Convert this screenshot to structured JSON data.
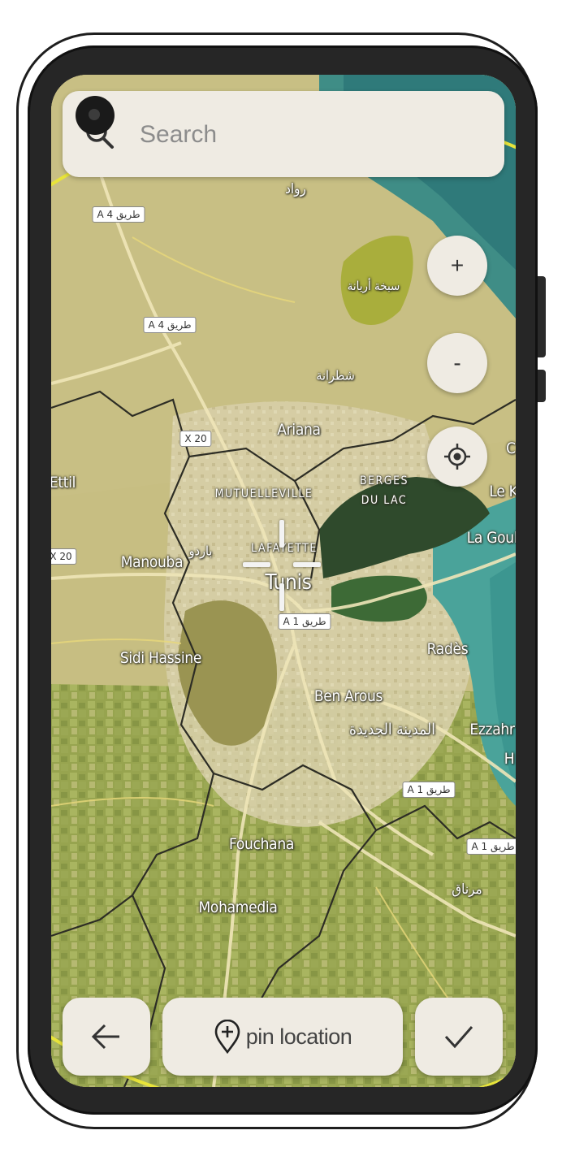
{
  "search": {
    "placeholder": "Search"
  },
  "map": {
    "labels": {
      "ariana": "Ariana",
      "mutuelleville": "MUTUELLEVILLE",
      "berges": "BERGES",
      "du_lac": "DU LAC",
      "lafayette": "LAFAYETTE",
      "tunis": "Tunis",
      "manouba": "Manouba",
      "sidi_hassine": "Sidi Hassine",
      "ben_arous": "Ben Arous",
      "rades": "Radès",
      "la_goulette": "La Goul",
      "le_k": "Le K",
      "fouchana": "Fouchana",
      "mohamedia": "Mohamedia",
      "ezzahra": "Ezzahr",
      "h": "H",
      "ettil": "Ettil",
      "c": "C",
      "arabic_sebkha": "سبخة أريانة",
      "arabic_raoued": "رواد",
      "arabic_chotrana": "شطرانة",
      "arabic_bardo": "باردو",
      "arabic_medina": "المدينة الجديدة",
      "arabic_mornag": "مرناق"
    },
    "shields": {
      "a4_top": "A 4 طريق",
      "a4_mid": "A 4 طريق",
      "x20_top": "X 20",
      "x20_left": "X 20",
      "a1_center": "A 1 طريق",
      "a1_right": "A 1 طريق",
      "a1_far": "A 1 طريق"
    }
  },
  "controls": {
    "zoom_in": "+",
    "zoom_out": "-",
    "locate_icon": "crosshair-target-icon"
  },
  "bottom_bar": {
    "back_icon": "arrow-left-icon",
    "pin_label": "pin location",
    "confirm_icon": "checkmark-icon"
  }
}
